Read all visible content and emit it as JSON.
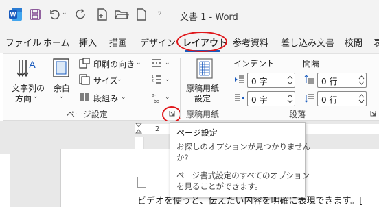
{
  "titlebar": {
    "title": "文書 1 - Word",
    "icons": [
      "word-icon",
      "save-icon",
      "undo-icon",
      "redo-icon",
      "new-doc-icon",
      "open-folder-icon",
      "blank-page-icon",
      "customize-dropdown-icon"
    ]
  },
  "tabs": [
    {
      "label": "ファイル"
    },
    {
      "label": "ホーム"
    },
    {
      "label": "挿入"
    },
    {
      "label": "描画"
    },
    {
      "label": "デザイン"
    },
    {
      "label": "レイアウト"
    },
    {
      "label": "参考資料"
    },
    {
      "label": "差し込み文書"
    },
    {
      "label": "校閲"
    },
    {
      "label": "表"
    }
  ],
  "ribbon": {
    "page_setup": {
      "text_direction_label_1": "文字列の",
      "text_direction_label_2": "方向",
      "margins_label": "余白",
      "orientation_label": "印刷の向き",
      "size_label": "サイズ",
      "columns_label": "段組み",
      "group_label": "ページ設定"
    },
    "genko": {
      "button_label_1": "原稿用紙",
      "button_label_2": "設定",
      "group_label": "原稿用紙"
    },
    "paragraph": {
      "indent_header": "インデント",
      "spacing_header": "間隔",
      "indent_left_value": "0 字",
      "indent_right_value": "0 字",
      "spacing_before_value": "0 行",
      "spacing_after_value": "0 行",
      "group_label": "段落"
    }
  },
  "ruler": {
    "tick_label": "2"
  },
  "tooltip": {
    "title": "ページ設定",
    "line1": "お探しのオプションが見つかりません",
    "line2": "か?",
    "line3": "ページ書式設定のすべてのオプション",
    "line4": "を見ることができます。"
  },
  "document": {
    "text": "ビデオを使うと、伝えたい内容を明確に表現できます。["
  },
  "colors": {
    "accent": "#185abd",
    "highlight_red": "#e0161a",
    "word_blue": "#185abd",
    "save_purple": "#7a3e8a"
  }
}
